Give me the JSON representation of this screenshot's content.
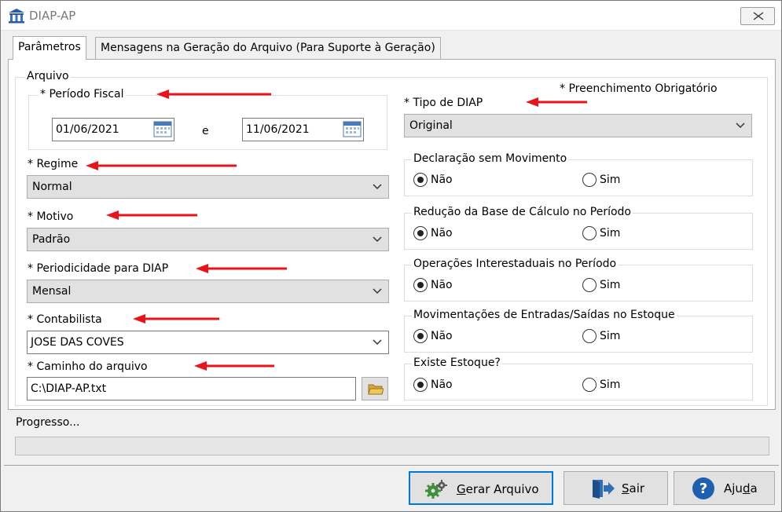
{
  "window": {
    "title": "DIAP-AP"
  },
  "tabs": [
    {
      "label": "Parâmetros",
      "active": true
    },
    {
      "label": "Mensagens na Geração do Arquivo (Para Suporte à Geração)",
      "active": false
    }
  ],
  "arquivo": {
    "legend": "Arquivo",
    "required_note": "* Preenchimento Obrigatório",
    "periodo": {
      "legend": "* Período Fiscal",
      "start": "01/06/2021",
      "separator": "e",
      "end": "11/06/2021"
    },
    "regime": {
      "label": "* Regime",
      "value": "Normal"
    },
    "motivo": {
      "label": "* Motivo",
      "value": "Padrão"
    },
    "periodicidade": {
      "label": "* Periodicidade para DIAP",
      "value": "Mensal"
    },
    "contabilista": {
      "label": "* Contabilista",
      "value": "JOSE DAS COVES"
    },
    "caminho": {
      "label": "* Caminho do arquivo",
      "value": "C:\\DIAP-AP.txt"
    },
    "tipo": {
      "label": "* Tipo de DIAP",
      "value": "Original"
    },
    "radio_groups": [
      {
        "legend": "Declaração sem Movimento",
        "no": "Não",
        "yes": "Sim",
        "selected": "Não"
      },
      {
        "legend": "Redução da Base de Cálculo no Período",
        "no": "Não",
        "yes": "Sim",
        "selected": "Não"
      },
      {
        "legend": "Operações Interestaduais no Período",
        "no": "Não",
        "yes": "Sim",
        "selected": "Não"
      },
      {
        "legend": "Movimentações de Entradas/Saídas no Estoque",
        "no": "Não",
        "yes": "Sim",
        "selected": "Não"
      },
      {
        "legend": "Existe Estoque?",
        "no": "Não",
        "yes": "Sim",
        "selected": "Não"
      }
    ]
  },
  "progress": {
    "label": "Progresso...",
    "value": 0
  },
  "buttons": {
    "gerar": {
      "mnemonic": "G",
      "rest": "erar Arquivo"
    },
    "sair": {
      "mnemonic": "S",
      "rest": "air"
    },
    "ajuda": {
      "prefix": "Aju",
      "mnemonic": "d",
      "rest": "a"
    }
  },
  "colors": {
    "annotation_arrow": "#e8141a",
    "focus_border": "#0078d7",
    "combo_bg": "#e1e1e1"
  },
  "icons": [
    "bank-icon",
    "close-icon",
    "calendar-icon",
    "chevron-down-icon",
    "folder-icon",
    "gears-icon",
    "exit-door-icon",
    "help-icon",
    "radio-button"
  ]
}
